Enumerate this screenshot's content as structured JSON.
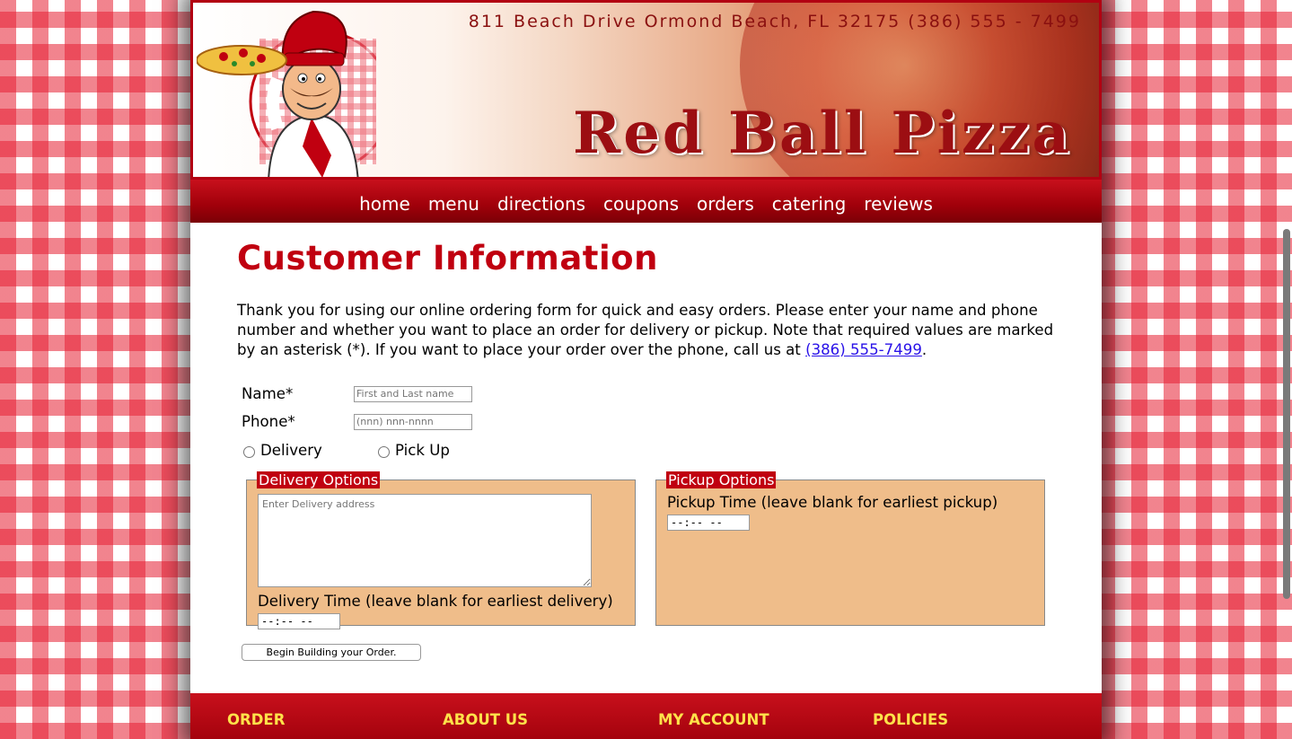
{
  "header": {
    "address": "811 Beach Drive  Ormond Beach, FL  32175   (386) 555 - 7499",
    "brand": "Red Ball Pizza"
  },
  "nav": [
    "home",
    "menu",
    "directions",
    "coupons",
    "orders",
    "catering",
    "reviews"
  ],
  "main": {
    "title": "Customer Information",
    "intro_text": "Thank you for using our online ordering form for quick and easy orders. Please enter your name and phone number and whether you want to place an order for delivery or pickup. Note that required values are marked by an asterisk (*). If you want to place your order over the phone, call us at ",
    "intro_link": "(386) 555-7499",
    "intro_end": "."
  },
  "form": {
    "name_label": "Name*",
    "name_placeholder": "First and Last name",
    "phone_label": "Phone*",
    "phone_placeholder": "(nnn) nnn-nnnn",
    "delivery_label": "Delivery",
    "pickup_label": "Pick Up",
    "delivery_legend": "Delivery Options",
    "delivery_address_placeholder": "Enter Delivery address",
    "delivery_time_label": "Delivery Time (leave blank for earliest delivery)",
    "delivery_time_value": "--:-- --",
    "pickup_legend": "Pickup Options",
    "pickup_time_label": "Pickup Time (leave blank for earliest pickup)",
    "pickup_time_value": "--:-- --",
    "submit_label": "Begin Building your Order."
  },
  "footer": [
    "ORDER",
    "ABOUT US",
    "MY ACCOUNT",
    "POLICIES"
  ],
  "colors": {
    "brand_red": "#c00010",
    "fieldset_bg": "#efbd8a",
    "footer_text": "#ffe24a"
  }
}
